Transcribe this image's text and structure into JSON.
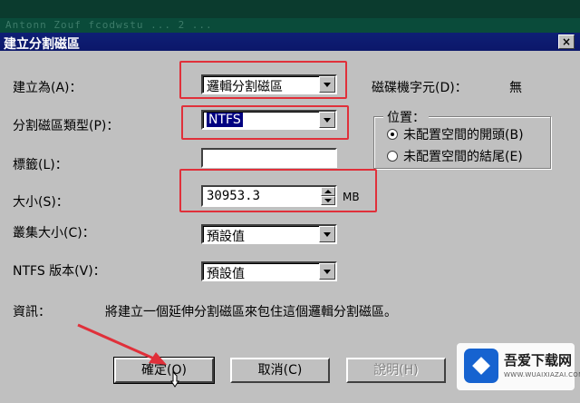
{
  "background": {
    "faded_text": "Antonn Zouf fcodwstu ... 2 ..."
  },
  "dialog": {
    "title": "建立分割磁區",
    "close_glyph": "×"
  },
  "fields": {
    "create_as": {
      "label": "建立為(A)：",
      "value": "邏輯分割磁區"
    },
    "drive_letter": {
      "label": "磁碟機字元(D)：",
      "value": "無"
    },
    "partition_type": {
      "label": "分割磁區類型(P)：",
      "value": "NTFS"
    },
    "volume_label": {
      "label": "標籤(L)：",
      "value": ""
    },
    "size": {
      "label": "大小(S)：",
      "value": "30953.3",
      "unit": "MB"
    },
    "cluster_size": {
      "label": "叢集大小(C)：",
      "value": "預設值"
    },
    "ntfs_version": {
      "label": "NTFS 版本(V)：",
      "value": "預設值"
    }
  },
  "position_group": {
    "legend": "位置：",
    "options": [
      {
        "label": "未配置空間的開頭(B)",
        "selected": true
      },
      {
        "label": "未配置空間的結尾(E)",
        "selected": false
      }
    ]
  },
  "info": {
    "label": "資訊：",
    "text": "將建立一個延伸分割磁區來包住這個邏輯分割磁區。"
  },
  "buttons": {
    "ok": "確定(O)",
    "cancel": "取消(C)",
    "help": "說明(H)"
  },
  "watermark": {
    "name": "吾爱下载网",
    "url": "WWW.WUAIXIAZAI.COM"
  },
  "colors": {
    "highlight": "#e0303a",
    "titlebar": "#0b176a",
    "selection": "#000080",
    "dialog": "#c0c0c0"
  }
}
